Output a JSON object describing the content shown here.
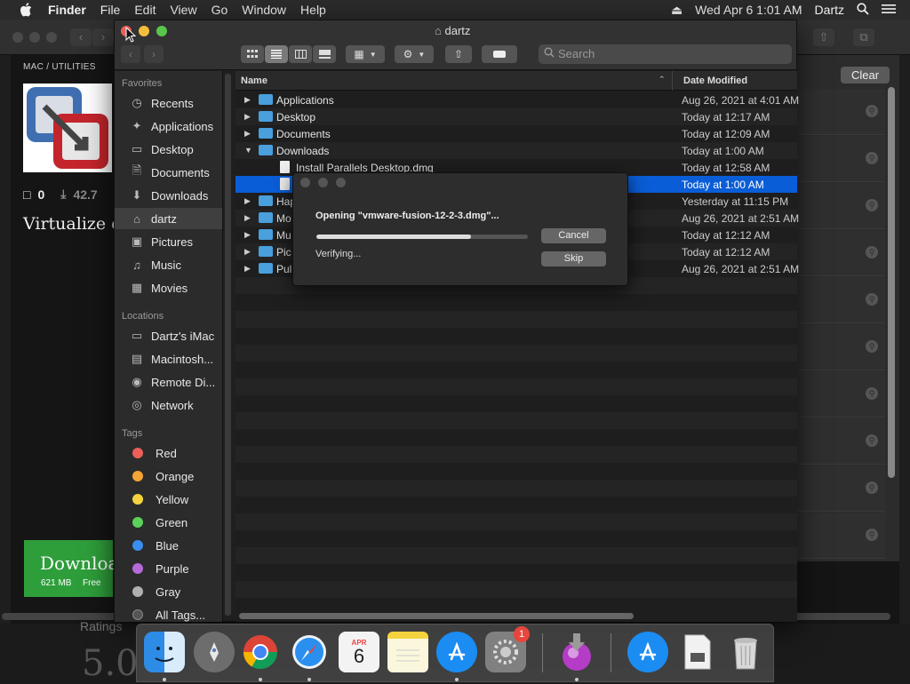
{
  "menubar": {
    "app_name": "Finder",
    "items": [
      "File",
      "Edit",
      "View",
      "Go",
      "Window",
      "Help"
    ],
    "datetime": "Wed Apr 6  1:01 AM",
    "user": "Dartz"
  },
  "background_page": {
    "breadcrumb": "MAC  /  UTILITIES",
    "comments": "0",
    "downloads": "42.7",
    "tagline": "Virtualize di",
    "download_button": {
      "label": "Downloa",
      "size": "621 MB",
      "price": "Free"
    },
    "ratings_label": "Ratings",
    "rating_value": "5.0",
    "clear_label": "Clear"
  },
  "finder": {
    "title": "dartz",
    "search_placeholder": "Search",
    "sidebar": {
      "favorites_head": "Favorites",
      "favorites": [
        "Recents",
        "Applications",
        "Desktop",
        "Documents",
        "Downloads",
        "dartz",
        "Pictures",
        "Music",
        "Movies"
      ],
      "locations_head": "Locations",
      "locations": [
        "Dartz's iMac",
        "Macintosh...",
        "Remote Di...",
        "Network"
      ],
      "tags_head": "Tags",
      "tags": [
        {
          "label": "Red",
          "color": "#ec5f59"
        },
        {
          "label": "Orange",
          "color": "#f4a536"
        },
        {
          "label": "Yellow",
          "color": "#f5d33e"
        },
        {
          "label": "Green",
          "color": "#5ad25a"
        },
        {
          "label": "Blue",
          "color": "#3a8ef0"
        },
        {
          "label": "Purple",
          "color": "#b56ad8"
        },
        {
          "label": "Gray",
          "color": "#b0b0b0"
        },
        {
          "label": "All Tags...",
          "color": "#555555"
        }
      ]
    },
    "columns": {
      "name": "Name",
      "date": "Date Modified"
    },
    "rows": [
      {
        "name": "Applications",
        "date": "Aug 26, 2021 at 4:01 AM"
      },
      {
        "name": "Desktop",
        "date": "Today at 12:17 AM"
      },
      {
        "name": "Documents",
        "date": "Today at 12:09 AM"
      },
      {
        "name": "Downloads",
        "date": "Today at 1:00 AM"
      },
      {
        "name": "Install Parallels Desktop.dmg",
        "date": "Today at 12:58 AM"
      },
      {
        "name": "",
        "date": "Today at 1:00 AM"
      },
      {
        "name": "Hap",
        "date": "Yesterday at 11:15 PM"
      },
      {
        "name": "Mo",
        "date": "Aug 26, 2021 at 2:51 AM"
      },
      {
        "name": "Mu",
        "date": "Today at 12:12 AM"
      },
      {
        "name": "Pic",
        "date": "Today at 12:12 AM"
      },
      {
        "name": "Pul",
        "date": "Aug 26, 2021 at 2:51 AM"
      }
    ]
  },
  "dialog": {
    "title": "Opening \"vmware-fusion-12-2-3.dmg\"...",
    "status": "Verifying...",
    "progress": 0.73,
    "cancel": "Cancel",
    "skip": "Skip"
  },
  "dock": {
    "items": [
      "finder-icon",
      "launchpad-icon",
      "chrome-icon",
      "safari-icon",
      "calendar-icon",
      "notes-icon",
      "app-store-icon",
      "system-preferences-icon",
      "downloads-stack-icon",
      "app-store-2-icon",
      "preview-icon",
      "trash-icon"
    ],
    "calendar_month": "APR",
    "calendar_day": "6",
    "badge": "1"
  },
  "colors": {
    "accent": "#0a5dd7",
    "folder": "#4a9fdd"
  }
}
